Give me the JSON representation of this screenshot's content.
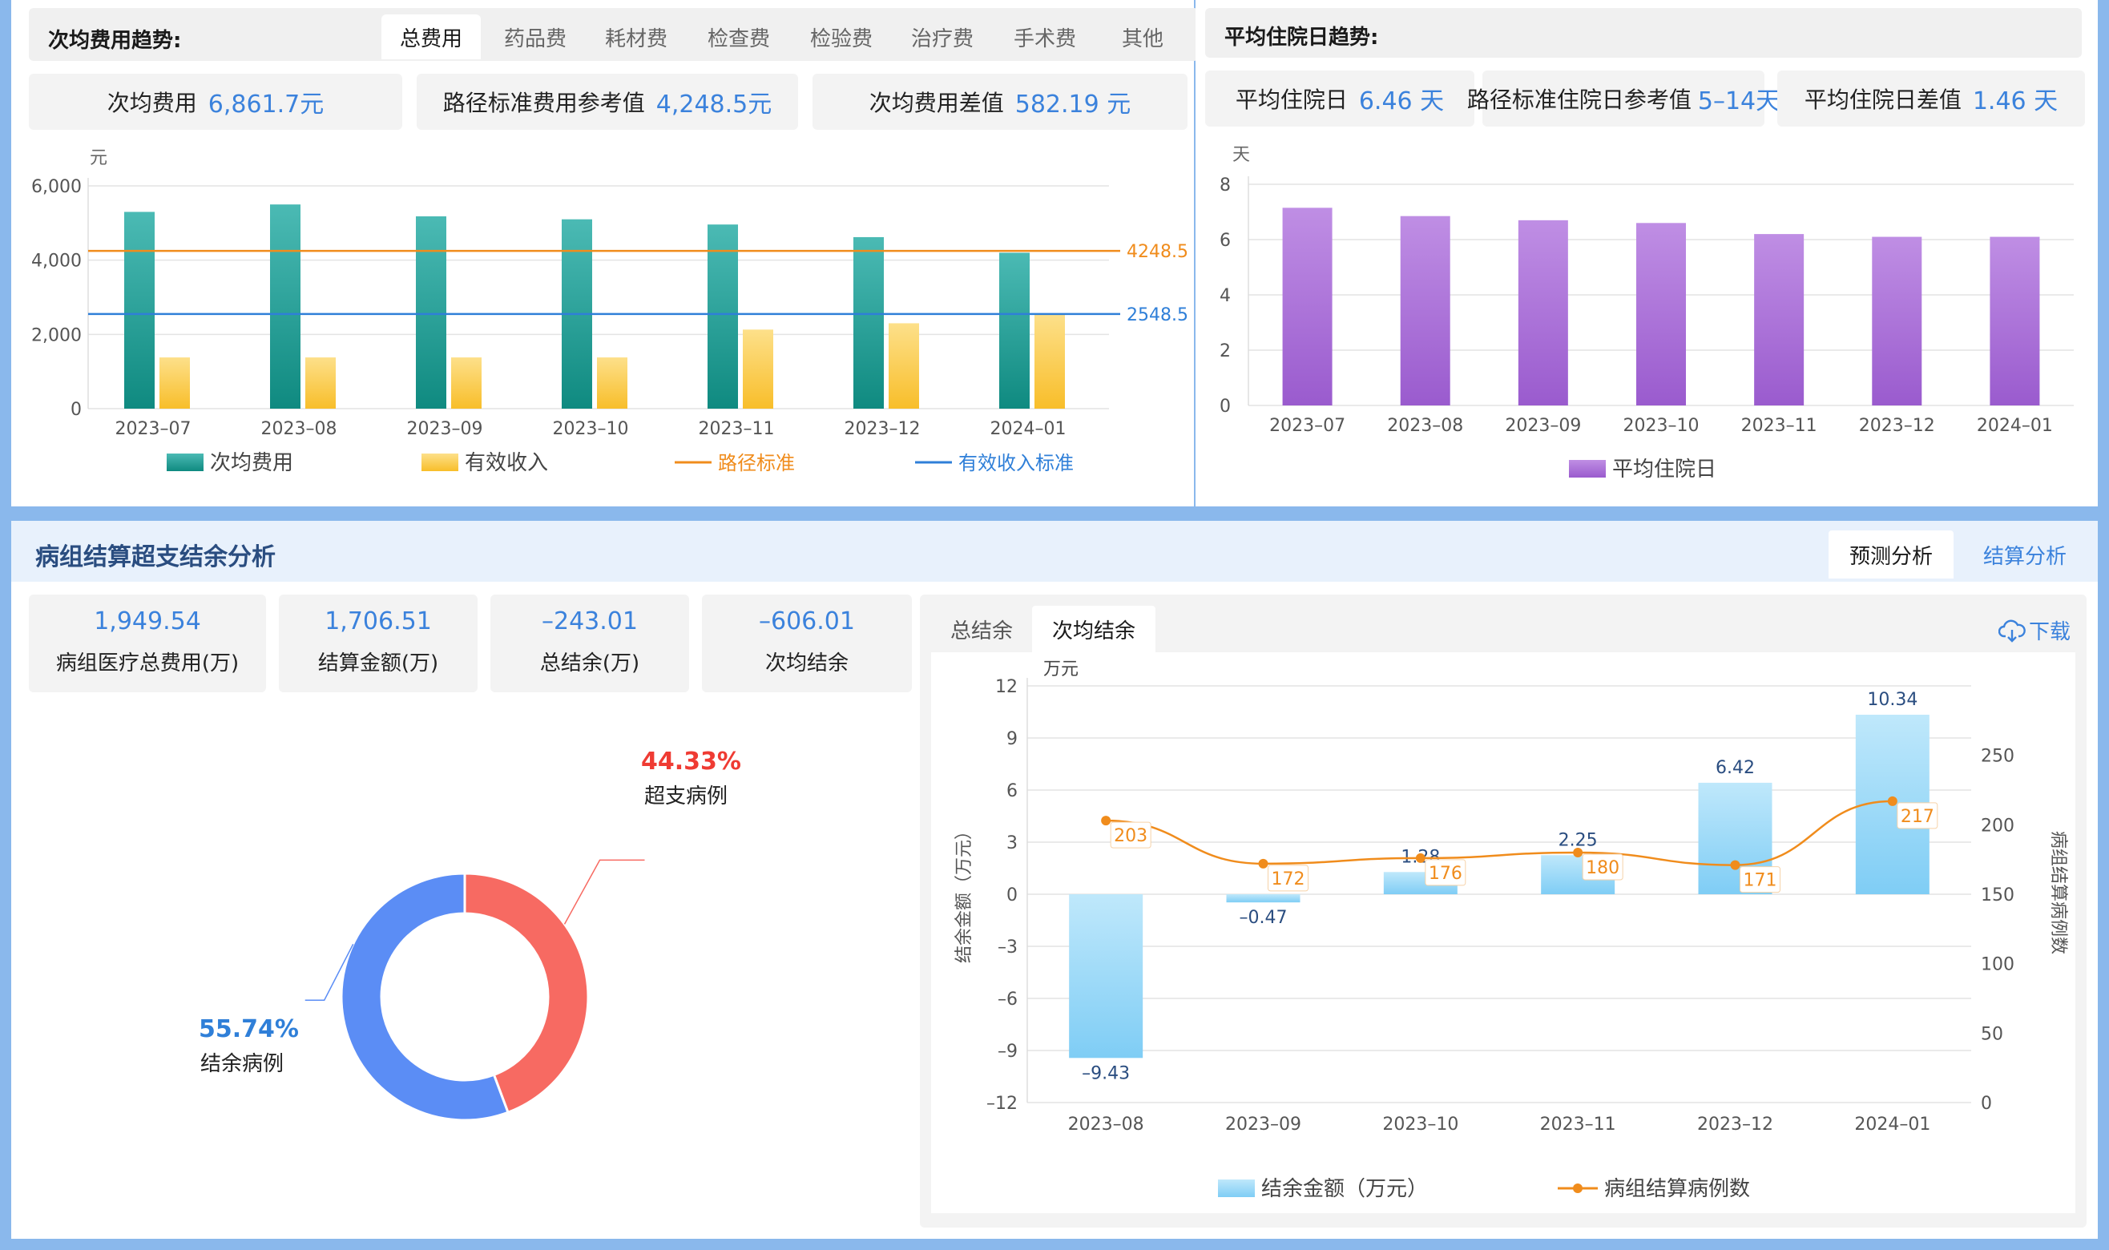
{
  "top_left": {
    "title": "次均费用趋势:",
    "tabs": [
      "总费用",
      "药品费",
      "耗材费",
      "检查费",
      "检验费",
      "治疗费",
      "手术费",
      "其他"
    ],
    "stats": [
      {
        "label": "次均费用",
        "value": "6,861.7元"
      },
      {
        "label": "路径标准费用参考值",
        "value": "4,248.5元"
      },
      {
        "label": "次均费用差值",
        "value": "582.19 元"
      }
    ]
  },
  "top_right": {
    "title": "平均住院日趋势:",
    "stats": [
      {
        "label": "平均住院日",
        "value": "6.46 天"
      },
      {
        "label": "路径标准住院日参考值",
        "value": "5–14天"
      },
      {
        "label": "平均住院日差值",
        "value": "1.46 天"
      }
    ]
  },
  "bottom": {
    "title": "病组结算超支结余分析",
    "view_tabs": [
      "预测分析",
      "结算分析"
    ],
    "kpis": [
      {
        "value": "1,949.54",
        "label": "病组医疗总费用(万)"
      },
      {
        "value": "1,706.51",
        "label": "结算金额(万)"
      },
      {
        "value": "–243.01",
        "label": "总结余(万)"
      },
      {
        "value": "–606.01",
        "label": "次均结余"
      }
    ],
    "sub_tabs": [
      "总结余",
      "次均结余"
    ],
    "download_label": "下载"
  },
  "colors": {
    "teal": "#1a9e94",
    "yellow": "#fbc94a",
    "orange": "#f08c1c",
    "blue_line": "#2f7fd8",
    "purple": "#a66ad4",
    "sky": "#8fd3f6",
    "red": "#f76a62",
    "donut_blue": "#5b8df5"
  },
  "chart_data": [
    {
      "type": "bar",
      "id": "cost_trend",
      "ylabel": "元",
      "ylim": [
        0,
        6000
      ],
      "yticks": [
        "0",
        "2,000",
        "4,000",
        "6,000"
      ],
      "categories": [
        "2023–07",
        "2023–08",
        "2023–09",
        "2023–10",
        "2023–11",
        "2023–12",
        "2024–01"
      ],
      "series": [
        {
          "name": "次均费用",
          "values": [
            5300,
            5500,
            5180,
            5100,
            4960,
            4620,
            4200
          ]
        },
        {
          "name": "有效收入",
          "values": [
            1380,
            1380,
            1380,
            1380,
            2130,
            2300,
            2550
          ]
        }
      ],
      "lines": [
        {
          "name": "路径标准",
          "value": 4248.5,
          "label": "4248.5"
        },
        {
          "name": "有效收入标准",
          "value": 2548.5,
          "label": "2548.5"
        }
      ]
    },
    {
      "type": "bar",
      "id": "stay_trend",
      "ylabel": "天",
      "ylim": [
        0,
        8
      ],
      "yticks": [
        "0",
        "2",
        "4",
        "6",
        "8"
      ],
      "categories": [
        "2023–07",
        "2023–08",
        "2023–09",
        "2023–10",
        "2023–11",
        "2023–12",
        "2024–01"
      ],
      "series": [
        {
          "name": "平均住院日",
          "values": [
            7.15,
            6.85,
            6.7,
            6.6,
            6.2,
            6.1,
            6.1
          ]
        }
      ]
    },
    {
      "type": "pie",
      "id": "case_ratio",
      "slices": [
        {
          "name": "超支病例",
          "value": 44.33,
          "label": "44.33%"
        },
        {
          "name": "结余病例",
          "value": 55.74,
          "label": "55.74%"
        }
      ]
    },
    {
      "type": "bar",
      "id": "settlement",
      "unit_label": "万元",
      "ylabel": "结余金额（万元）",
      "y2label": "病组结算病例数",
      "ylim": [
        -12,
        12
      ],
      "yticks": [
        "–12",
        "–9",
        "–6",
        "–3",
        "0",
        "3",
        "6",
        "9",
        "12"
      ],
      "y2lim": [
        0,
        300
      ],
      "y2ticks": [
        "0",
        "50",
        "100",
        "150",
        "200",
        "250"
      ],
      "categories": [
        "2023–08",
        "2023–09",
        "2023–10",
        "2023–11",
        "2023–12",
        "2024–01"
      ],
      "series": [
        {
          "name": "结余金额（万元）",
          "values": [
            -9.43,
            -0.47,
            1.28,
            2.25,
            6.42,
            10.34
          ],
          "labels": [
            "–9.43",
            "–0.47",
            "1.28",
            "2.25",
            "6.42",
            "10.34"
          ]
        },
        {
          "name": "病组结算病例数",
          "values": [
            203,
            172,
            176,
            180,
            171,
            217
          ],
          "labels": [
            "203",
            "172",
            "176",
            "180",
            "171",
            "217"
          ]
        }
      ]
    }
  ]
}
